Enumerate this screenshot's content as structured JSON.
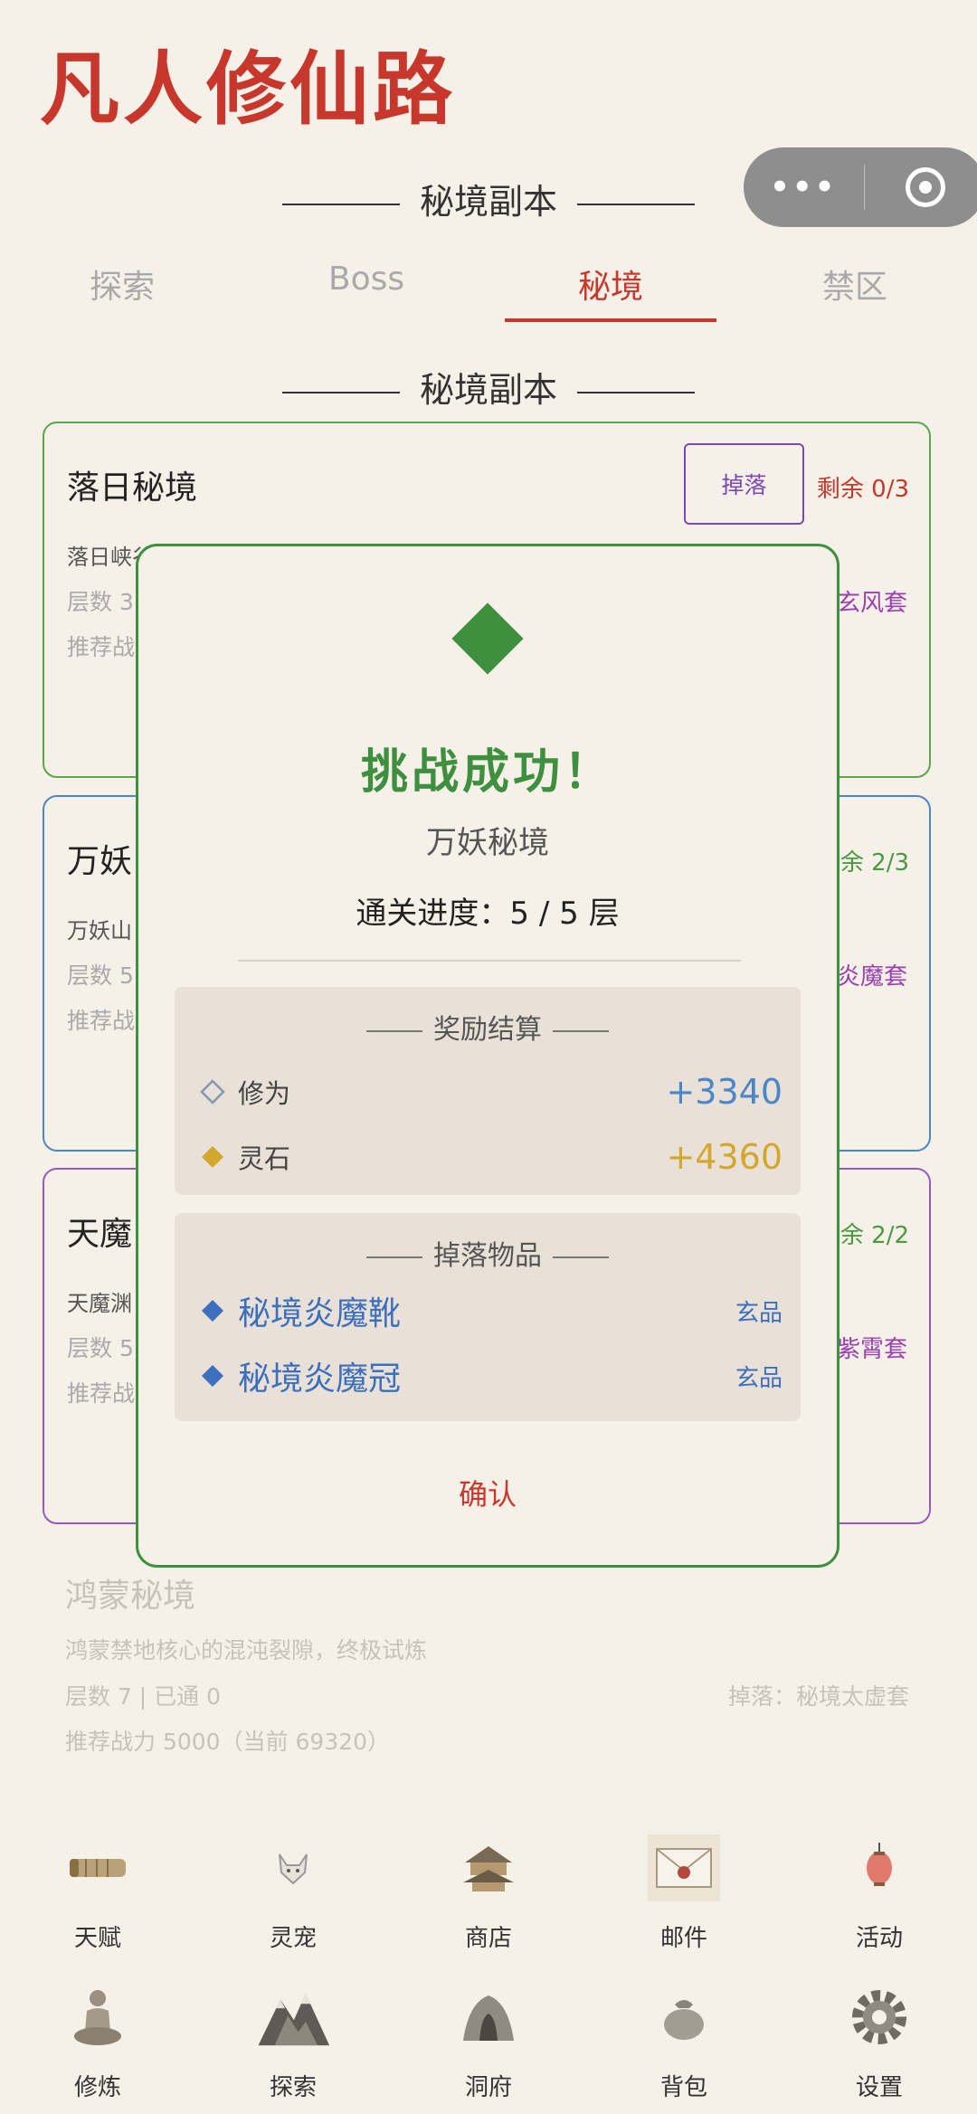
{
  "app_title": "凡人修仙路",
  "top_heading": "秘境副本",
  "tabs": [
    {
      "label": "探索"
    },
    {
      "label": "Boss"
    },
    {
      "label": "秘境"
    },
    {
      "label": "禁区"
    }
  ],
  "list_heading": "秘境副本",
  "cards": [
    {
      "name": "落日秘境",
      "desc": "落日峡谷",
      "layer": "层数 3",
      "rec": "推荐战",
      "remain": "剩余 0/3",
      "set": "玄风套",
      "drop_label": "掉落",
      "color": "#5aa64a"
    },
    {
      "name": "万妖",
      "desc": "万妖山",
      "layer": "层数 5",
      "rec": "推荐战",
      "remain": "余 2/3",
      "set": "炎魔套",
      "color": "#4a86c8"
    },
    {
      "name": "天魔",
      "desc": "天魔渊",
      "layer": "层数 5",
      "rec": "推荐战",
      "remain": "余 2/2",
      "set": "紫霄套",
      "color": "#9b57c0"
    }
  ],
  "last_card": {
    "name": "鸿蒙秘境",
    "desc": "鸿蒙禁地核心的混沌裂隙，终极试炼",
    "layer": "层数 7 | 已通 0",
    "drop": "掉落：秘境太虚套",
    "rec": "推荐战力 5000（当前 69320）"
  },
  "nav_top": [
    {
      "label": "天赋",
      "icon": "scroll-icon"
    },
    {
      "label": "灵宠",
      "icon": "fox-icon"
    },
    {
      "label": "商店",
      "icon": "pavilion-icon"
    },
    {
      "label": "邮件",
      "icon": "envelope-icon"
    },
    {
      "label": "活动",
      "icon": "lantern-icon"
    }
  ],
  "nav_bottom": [
    {
      "label": "修炼",
      "icon": "meditation-icon"
    },
    {
      "label": "探索",
      "icon": "mountain-icon"
    },
    {
      "label": "洞府",
      "icon": "cave-icon"
    },
    {
      "label": "背包",
      "icon": "bag-icon"
    },
    {
      "label": "设置",
      "icon": "gear-icon"
    }
  ],
  "modal": {
    "title": "挑战成功！",
    "dungeon": "万妖秘境",
    "progress": "通关进度：5 / 5 层",
    "rewards_title": "奖励结算",
    "rewards": [
      {
        "label": "修为",
        "value": "+3340",
        "color": "#4a86c8"
      },
      {
        "label": "灵石",
        "value": "+4360",
        "color": "#d3a72e"
      }
    ],
    "drops_title": "掉落物品",
    "drops": [
      {
        "name": "秘境炎魔靴",
        "grade": "玄品"
      },
      {
        "name": "秘境炎魔冠",
        "grade": "玄品"
      }
    ],
    "confirm": "确认",
    "accent": "#3e8f3e"
  }
}
